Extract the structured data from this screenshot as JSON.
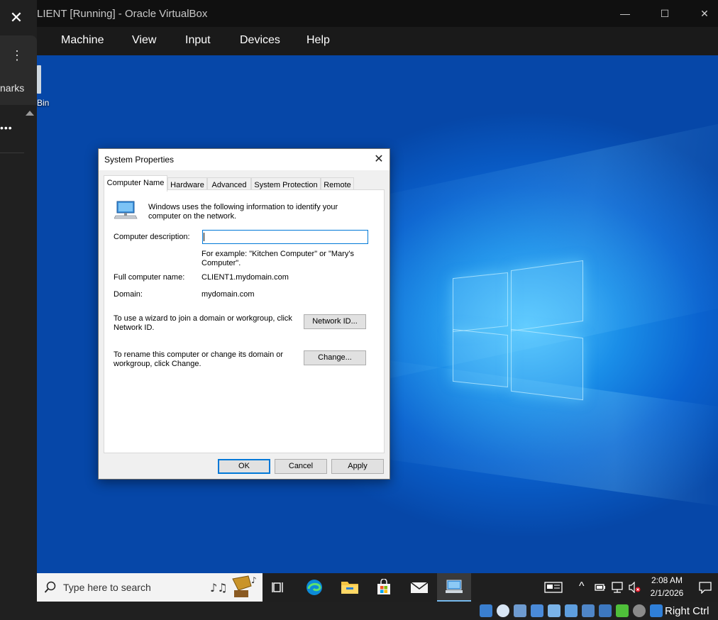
{
  "host": {
    "close_glyph": "✕",
    "kebab_glyph": "⋮",
    "bookmarks_partial": "narks",
    "dots": "•••"
  },
  "vm_window": {
    "title": "LIENT [Running] - Oracle VirtualBox",
    "controls": {
      "minimize": "—",
      "maximize": "☐",
      "close": "✕"
    },
    "menu": [
      "Machine",
      "View",
      "Input",
      "Devices",
      "Help"
    ]
  },
  "desktop": {
    "recycle_bin_label": "Bin",
    "accent_color": "#0a62cf"
  },
  "dialog": {
    "title": "System Properties",
    "close_glyph": "✕",
    "tabs": [
      "Computer Name",
      "Hardware",
      "Advanced",
      "System Protection",
      "Remote"
    ],
    "active_tab": "Computer Name",
    "intro_text": "Windows uses the following information to identify your computer on the network.",
    "description_label": "Computer description:",
    "description_value": "",
    "example_text": "For example: \"Kitchen Computer\" or \"Mary's Computer\".",
    "full_name_label": "Full computer name:",
    "full_name_value": "CLIENT1.mydomain.com",
    "domain_label": "Domain:",
    "domain_value": "mydomain.com",
    "wizard_text": "To use a wizard to join a domain or workgroup, click Network ID.",
    "network_id_button": "Network ID...",
    "rename_text": "To rename this computer or change its domain or workgroup, click Change.",
    "change_button": "Change...",
    "ok_button": "OK",
    "cancel_button": "Cancel",
    "apply_button": "Apply"
  },
  "taskbar": {
    "search_placeholder": "Type here to search",
    "time": "2:08 AM",
    "date": "2/1/2026",
    "chevron_glyph": "^"
  },
  "statusbar": {
    "host_key": "Right Ctrl"
  }
}
